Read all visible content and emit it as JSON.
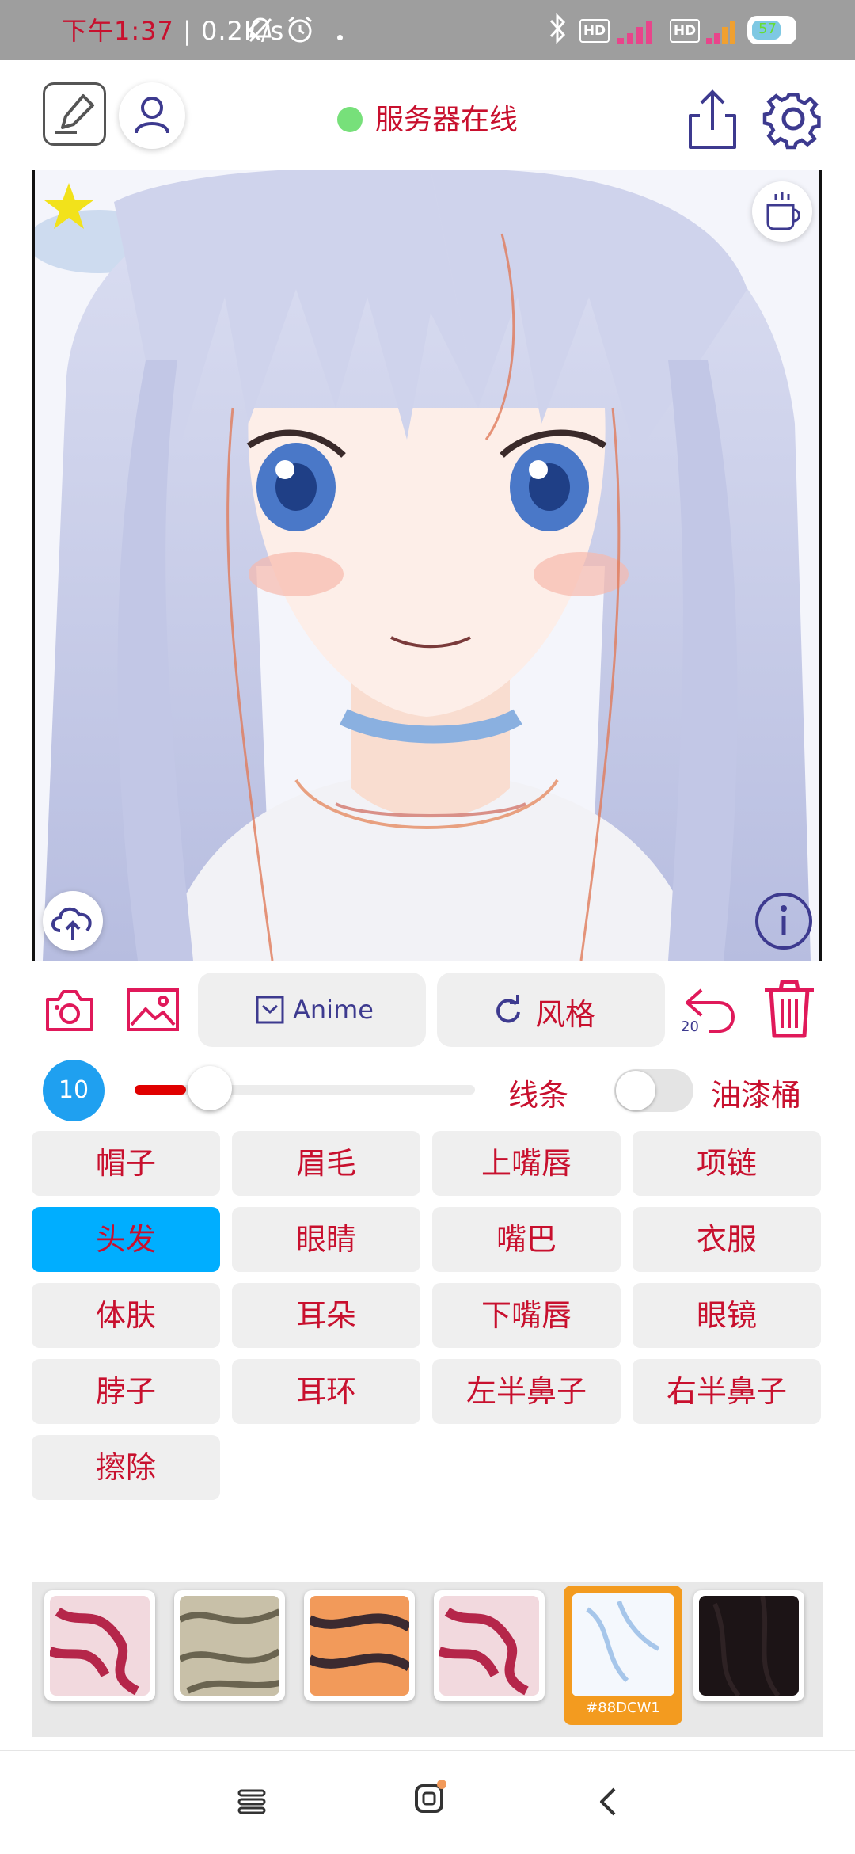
{
  "status_bar": {
    "time": "下午1:37",
    "net_speed": "0.2K/s",
    "battery": "57",
    "icons": [
      "bell-off-icon",
      "alarm-icon",
      "bluetooth-icon",
      "hd-icon",
      "signal-icon",
      "hd-icon",
      "signal-icon",
      "battery-icon"
    ]
  },
  "header": {
    "server_status": "服务器在线",
    "status_color": "#77e07a",
    "icons": [
      "edit-icon",
      "user-icon",
      "share-icon",
      "gear-icon"
    ]
  },
  "canvas": {
    "icons": [
      "star-icon",
      "coffee-icon",
      "upload-cloud-icon",
      "info-icon"
    ]
  },
  "toolbar": {
    "model_label": "Anime",
    "style_label": "风格",
    "undo_count": "20",
    "icons": [
      "camera-icon",
      "image-icon",
      "checkbox-icon",
      "refresh-icon",
      "undo-icon",
      "trash-icon"
    ]
  },
  "brush": {
    "size": "10",
    "slider_fraction": 0.15,
    "line_label": "线条",
    "bucket_label": "油漆桶",
    "bucket_toggle": false
  },
  "parts": [
    {
      "label": "帽子"
    },
    {
      "label": "眉毛"
    },
    {
      "label": "上嘴唇"
    },
    {
      "label": "项链"
    },
    {
      "label": "头发",
      "selected": true
    },
    {
      "label": "眼睛"
    },
    {
      "label": "嘴巴"
    },
    {
      "label": "衣服"
    },
    {
      "label": "体肤"
    },
    {
      "label": "耳朵"
    },
    {
      "label": "下嘴唇"
    },
    {
      "label": "眼镜"
    },
    {
      "label": "脖子"
    },
    {
      "label": "耳环"
    },
    {
      "label": "左半鼻子"
    },
    {
      "label": "右半鼻子"
    },
    {
      "label": "擦除"
    }
  ],
  "swatches": {
    "selected_code": "#88DCW1",
    "accent": "#f39b1f"
  }
}
